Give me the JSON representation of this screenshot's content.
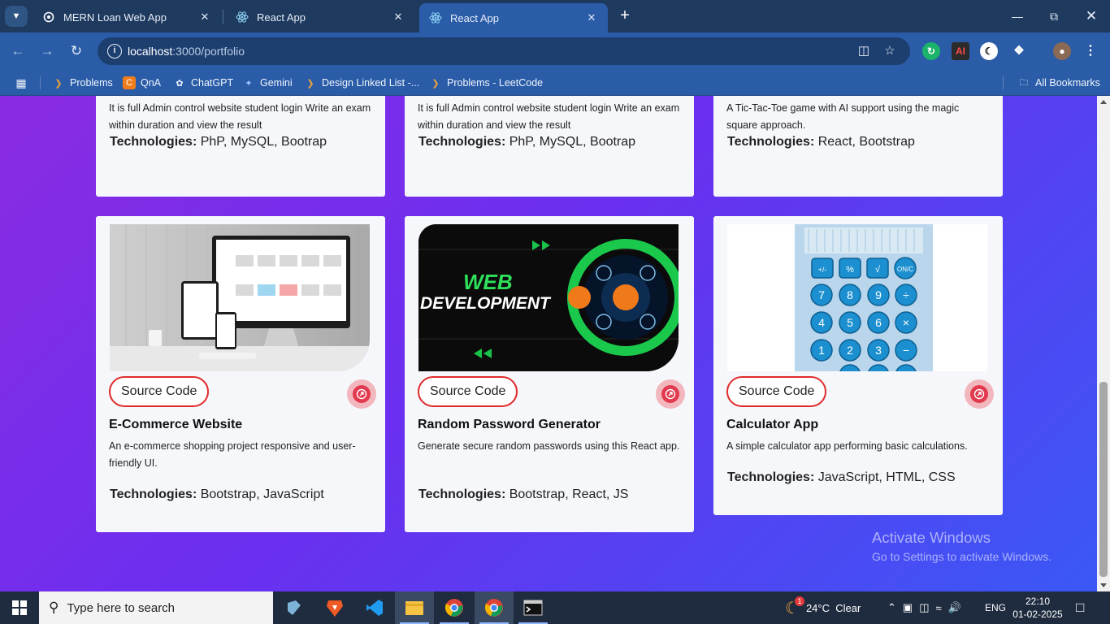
{
  "browser": {
    "tabs": [
      {
        "label": "MERN Loan Web App",
        "active": false
      },
      {
        "label": "React App",
        "active": false
      },
      {
        "label": "React App",
        "active": true
      }
    ],
    "url_host": "localhost",
    "url_path": ":3000/portfolio",
    "bookmarks": [
      "Problems",
      "QnA",
      "ChatGPT",
      "Gemini",
      "Design Linked List -...",
      "Problems - LeetCode"
    ],
    "all_bookmarks": "All Bookmarks"
  },
  "top_cards": [
    {
      "desc": "It is full Admin control website student login Write an exam within duration and view the result",
      "tech_label": "Technologies:",
      "tech": " PhP, MySQL, Bootrap"
    },
    {
      "desc": "It is full Admin control website student login Write an exam within duration and view the result",
      "tech_label": "Technologies:",
      "tech": " PhP, MySQL, Bootrap"
    },
    {
      "desc": "A Tic-Tac-Toe game with AI support using the magic square approach.",
      "tech_label": "Technologies:",
      "tech": " React, Bootstrap"
    }
  ],
  "bottom_cards": [
    {
      "source": "Source Code",
      "title": "E-Commerce Website",
      "desc": "An e-commerce shopping project responsive and user-friendly UI.",
      "tech_label": "Technologies:",
      "tech": " Bootstrap, JavaScript"
    },
    {
      "source": "Source Code",
      "title": "Random Password Generator",
      "desc": "Generate secure random passwords using this React app.",
      "tech_label": "Technologies:",
      "tech": " Bootstrap, React, JS",
      "image_text_1": "WEB",
      "image_text_2": "DEVELOPMENT"
    },
    {
      "source": "Source Code",
      "title": "Calculator App",
      "desc": "A simple calculator app performing basic calculations.",
      "tech_label": "Technologies:",
      "tech": " JavaScript, HTML, CSS"
    }
  ],
  "watermark": {
    "line1": "Activate Windows",
    "line2": "Go to Settings to activate Windows."
  },
  "taskbar": {
    "search_placeholder": "Type here to search",
    "weather": "24°C  Clear",
    "weather_badge": "1",
    "lang": "ENG",
    "time": "22:10",
    "date": "01-02-2025"
  },
  "colors": {
    "accent_red": "#e02a2a",
    "chrome_blue": "#2a5ca8",
    "gradient_start": "#8a2be2",
    "gradient_end": "#3a58f5"
  }
}
